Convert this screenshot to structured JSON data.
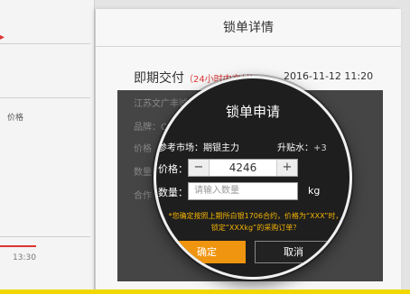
{
  "left_list": {
    "price_label": "价格",
    "time": "13:30"
  },
  "detail": {
    "header_title": "锁单详情",
    "delivery_type": "即期交付",
    "delivery_note": "（24小时内交付）",
    "datetime": "2016-11-12 11:20",
    "bg_lines": [
      "江苏文广丰诚进出口贸易有限公司",
      "品牌：CHANGSHA",
      "价格",
      "数量",
      "合作"
    ]
  },
  "modal": {
    "title": "锁单申请"
  },
  "magnifier": {
    "title": "锁单申请",
    "ref_market_label": "参考市场：期银主力",
    "premium_label": "升贴水：",
    "premium_value": "+3",
    "price_label": "价格：",
    "price_value": "4246",
    "minus": "−",
    "plus": "+",
    "qty_label": "数量：",
    "qty_placeholder": "请输入数量",
    "unit": "kg",
    "note_line1": "*您确定按照上期所白银1706合约，价格为“XXX”时，",
    "note_line2": "锁定“XXXkg”的采购订单？",
    "confirm_label": "确定",
    "cancel_label": "取消"
  },
  "colors": {
    "accent_orange": "#f0950f",
    "warning_text": "#f5b400",
    "alert_red": "#dd3333"
  }
}
